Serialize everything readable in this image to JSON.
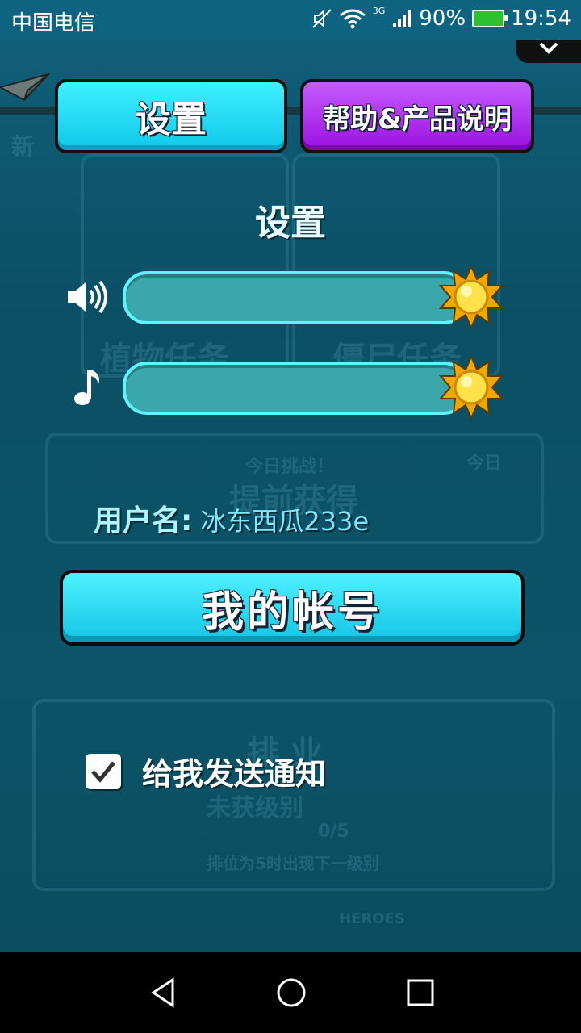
{
  "status_bar": {
    "carrier": "中国电信",
    "network": "3G",
    "battery": "90%",
    "time": "19:54"
  },
  "tabs": {
    "settings": "设置",
    "help": "帮助&产品说明"
  },
  "background_text": {
    "new": "新",
    "plant_task": "植物任务",
    "zombie_task": "僵尸任务",
    "today_challenge": "今日挑战！",
    "early_get": "提前获得",
    "today": "今日",
    "rank": "排 业",
    "unlock_level": "未获级别",
    "progress": "0/5",
    "rank_hint": "排位为5时出现下一级别",
    "heroes": "HEROES"
  },
  "settings": {
    "title": "设置",
    "sound_icon": "speaker-icon",
    "music_icon": "music-note-icon",
    "sound_level": 1.0,
    "music_level": 1.0,
    "username_label": "用户名:",
    "username_value": "冰东西瓜233e",
    "account_button": "我的帐号",
    "notify_label": "给我发送通知",
    "notify_checked": true
  },
  "colors": {
    "accent_cyan": "#12c4e4",
    "accent_purple": "#9b10e0",
    "background": "#0c5266"
  }
}
